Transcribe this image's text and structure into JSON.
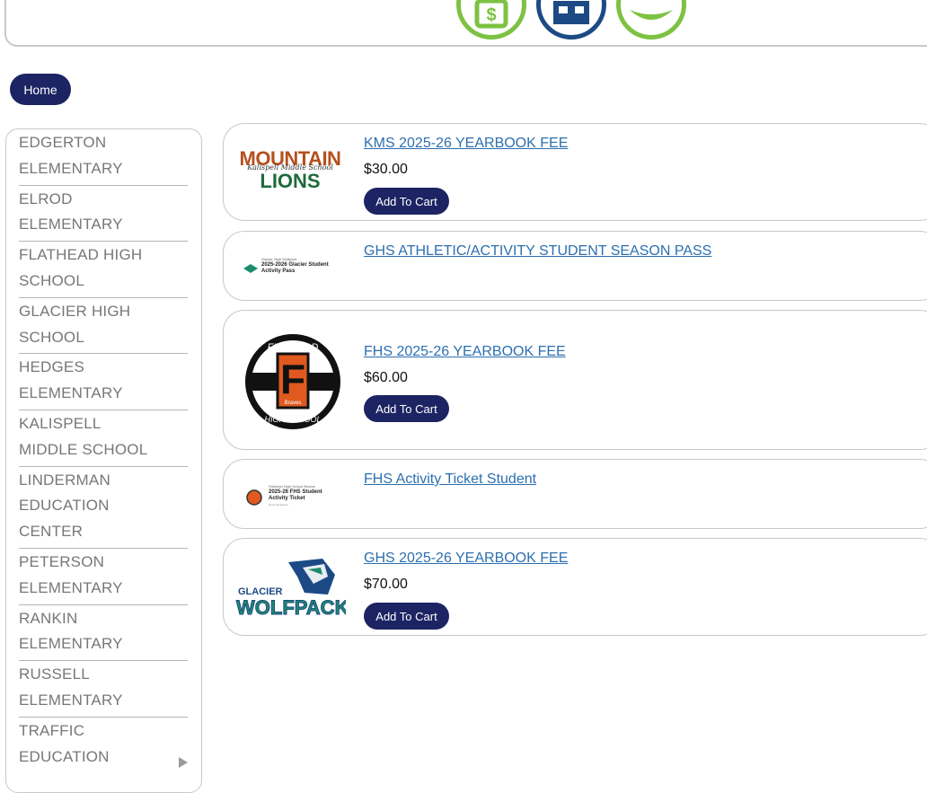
{
  "nav": {
    "home_label": "Home"
  },
  "sidebar": {
    "items": [
      {
        "label": "EDGERTON ELEMENTARY"
      },
      {
        "label": "ELROD ELEMENTARY"
      },
      {
        "label": "FLATHEAD HIGH SCHOOL"
      },
      {
        "label": "GLACIER HIGH SCHOOL"
      },
      {
        "label": "HEDGES ELEMENTARY"
      },
      {
        "label": "KALISPELL MIDDLE SCHOOL"
      },
      {
        "label": "LINDERMAN EDUCATION CENTER"
      },
      {
        "label": "PETERSON ELEMENTARY"
      },
      {
        "label": "RANKIN ELEMENTARY"
      },
      {
        "label": "RUSSELL ELEMENTARY"
      },
      {
        "label": "TRAFFIC EDUCATION"
      }
    ]
  },
  "products": [
    {
      "title": "KMS 2025-26 YEARBOOK FEE",
      "price": "$30.00",
      "cart_label": "Add To Cart",
      "logo": {
        "line1": "MOUNTAIN",
        "line2": "LIONS",
        "script": "Kalispell Middle School"
      }
    },
    {
      "title": "GHS ATHLETIC/ACTIVITY STUDENT SEASON PASS",
      "logo": {
        "small": "Glacier High Wolfpack",
        "line1": "2025-2026 Glacier Student",
        "line2": "Activity Pass"
      }
    },
    {
      "title": "FHS 2025-26 YEARBOOK FEE",
      "price": "$60.00",
      "cart_label": "Add To Cart",
      "logo": {
        "top": "FLATHEAD",
        "letter": "F",
        "tag": "Braves",
        "bottom": "HIGH SCHOOL"
      }
    },
    {
      "title": "FHS Activity Ticket Student",
      "logo": {
        "small": "Flathead High School Braves",
        "line1": "2025-26 FHS Student",
        "line2": "Activity Ticket",
        "tiny": "Good all season"
      }
    },
    {
      "title": "GHS 2025-26 YEARBOOK FEE",
      "price": "$70.00",
      "cart_label": "Add To Cart",
      "logo": {
        "line1": "GLACIER",
        "line2": "WOLFPACK"
      }
    }
  ],
  "colors": {
    "navy": "#1c2463",
    "link": "#2c6fb0",
    "green": "#7dc242",
    "blue": "#1c4a85",
    "orange": "#b5501e",
    "teal": "#1d8c6a"
  }
}
